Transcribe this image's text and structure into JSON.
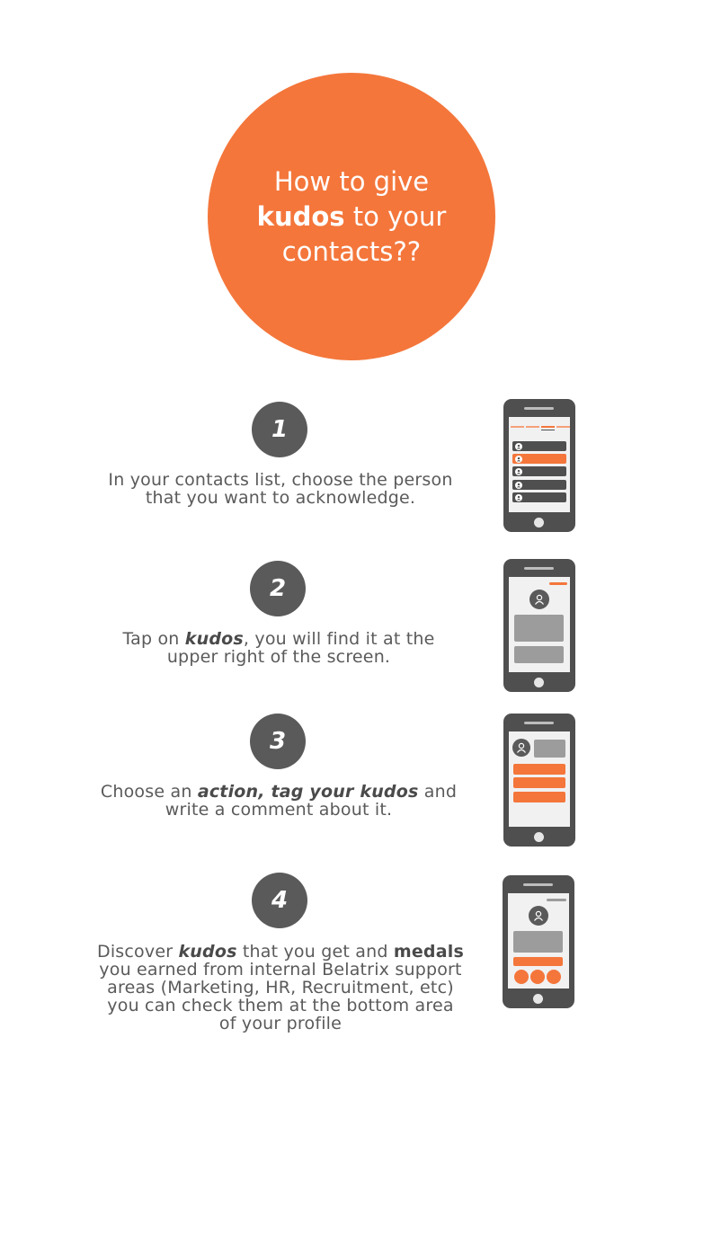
{
  "hero": {
    "line1": "How to give",
    "line2_bold": "kudos",
    "line2_rest": " to your",
    "line3": "contacts??"
  },
  "steps": [
    {
      "number": "1",
      "line1": "In your contacts list, choose the person",
      "line2": "that you want to acknowledge."
    },
    {
      "number": "2",
      "line1_pre": "Tap on ",
      "line1_bold": "kudos",
      "line1_post": ", you will find it at the",
      "line2": "upper right of the screen."
    },
    {
      "number": "3",
      "line1_pre": "Choose an ",
      "line1_bold": "action, tag your kudos",
      "line1_post": " and",
      "line2": "write a comment about it."
    },
    {
      "number": "4",
      "line1_pre": "Discover ",
      "line1_bold1": "kudos",
      "line1_mid": " that you get and ",
      "line1_bold2": "medals",
      "line2": "you earned from internal Belatrix support",
      "line3": "areas (Marketing, HR, Recruitment, etc)",
      "line4": "you can check them at the bottom area",
      "line5": "of your profile"
    }
  ],
  "colors": {
    "accent": "#f4763b",
    "dark": "#4f4f4f",
    "text": "#5a5a5a",
    "screen": "#f1f1f1"
  },
  "icons": {
    "phone": "smartphone-icon",
    "avatar": "user-avatar-icon"
  }
}
